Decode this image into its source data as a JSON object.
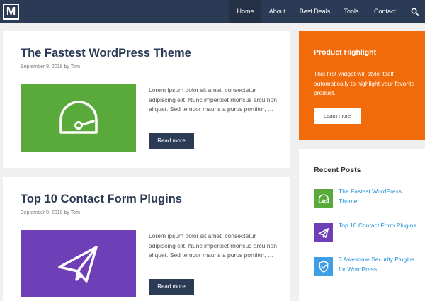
{
  "logo": {
    "letter": "M"
  },
  "nav": {
    "items": [
      {
        "label": "Home",
        "active": true
      },
      {
        "label": "About"
      },
      {
        "label": "Best Deals"
      },
      {
        "label": "Tools"
      },
      {
        "label": "Contact"
      }
    ],
    "search_icon": "search-icon"
  },
  "posts": [
    {
      "title": "The Fastest WordPress Theme",
      "meta": "September 8, 2018 by Tom",
      "thumb_color": "#5aa93b",
      "thumb_icon": "speedometer-icon",
      "excerpt": "Lorem ipsum dolor sit amet, consectetur adipiscing elit. Nunc imperdiet rhoncus arcu non aliquet. Sed tempor mauris a purus porttitor, …",
      "button": "Read more"
    },
    {
      "title": "Top 10 Contact Form Plugins",
      "meta": "September 8, 2018 by Tom",
      "thumb_color": "#6f3fb8",
      "thumb_icon": "paper-plane-icon",
      "excerpt": "Lorem ipsum dolor sit amet, consectetur adipiscing elit. Nunc imperdiet rhoncus arcu non aliquet. Sed tempor mauris a purus porttitor, …",
      "button": "Read more"
    }
  ],
  "highlight": {
    "title": "Product Highlight",
    "text": "This first widget will style itself automatically to highlight your favorite product.",
    "button": "Learn more",
    "color": "#f16b0a"
  },
  "recent_posts": {
    "title": "Recent Posts",
    "items": [
      {
        "label": "The Fastest WordPress Theme",
        "color": "#5aa93b",
        "icon": "speedometer-icon"
      },
      {
        "label": "Top 10 Contact Form Plugins",
        "color": "#6f3fb8",
        "icon": "paper-plane-icon"
      },
      {
        "label": "3 Awesome Security Plugins for WordPress",
        "color": "#3f9fe6",
        "icon": "shield-check-icon"
      }
    ]
  }
}
